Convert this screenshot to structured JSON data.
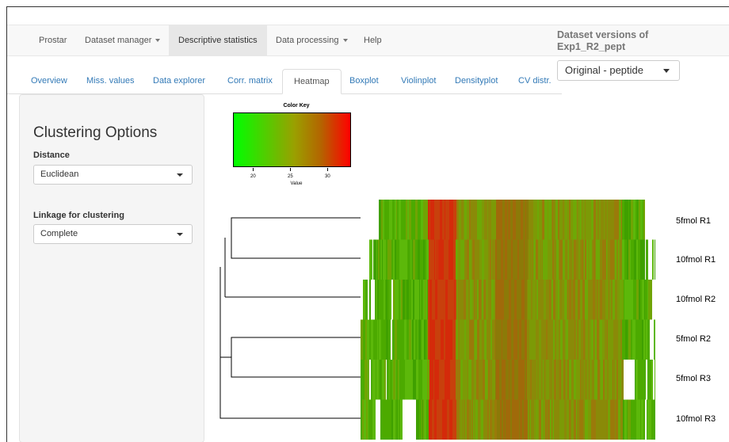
{
  "navbar": {
    "items": [
      {
        "label": "Prostar",
        "caret": false,
        "active": false
      },
      {
        "label": "Dataset manager",
        "caret": true,
        "active": false
      },
      {
        "label": "Descriptive statistics",
        "caret": false,
        "active": true
      },
      {
        "label": "Data processing",
        "caret": true,
        "active": false
      },
      {
        "label": "Help",
        "caret": false,
        "active": false
      }
    ]
  },
  "dataset_versions": {
    "title": "Dataset versions of Exp1_R2_pept",
    "selected": "Original - peptide"
  },
  "tabs": [
    {
      "label": "Overview",
      "active": false
    },
    {
      "label": "Miss. values",
      "active": false
    },
    {
      "label": "Data explorer",
      "active": false
    },
    {
      "label": "Corr. matrix",
      "active": false
    },
    {
      "label": "Heatmap",
      "active": true
    },
    {
      "label": "Boxplot",
      "active": false
    },
    {
      "label": "Violinplot",
      "active": false
    },
    {
      "label": "Densityplot",
      "active": false
    },
    {
      "label": "CV distr.",
      "active": false
    }
  ],
  "sidebar": {
    "title": "Clustering Options",
    "distance": {
      "label": "Distance",
      "value": "Euclidean"
    },
    "linkage": {
      "label": "Linkage for clustering",
      "value": "Complete"
    }
  },
  "color_key": {
    "title": "Color Key",
    "ticks": [
      "20",
      "25",
      "30"
    ],
    "xlabel": "Value",
    "colors": {
      "low": "#00ff00",
      "mid": "#9aa000",
      "high": "#ff0000"
    }
  },
  "heatmap": {
    "rows": [
      "5fmol R1",
      "10fmol R1",
      "10fmol R2",
      "5fmol R2",
      "5fmol R3",
      "10fmol R3"
    ]
  }
}
